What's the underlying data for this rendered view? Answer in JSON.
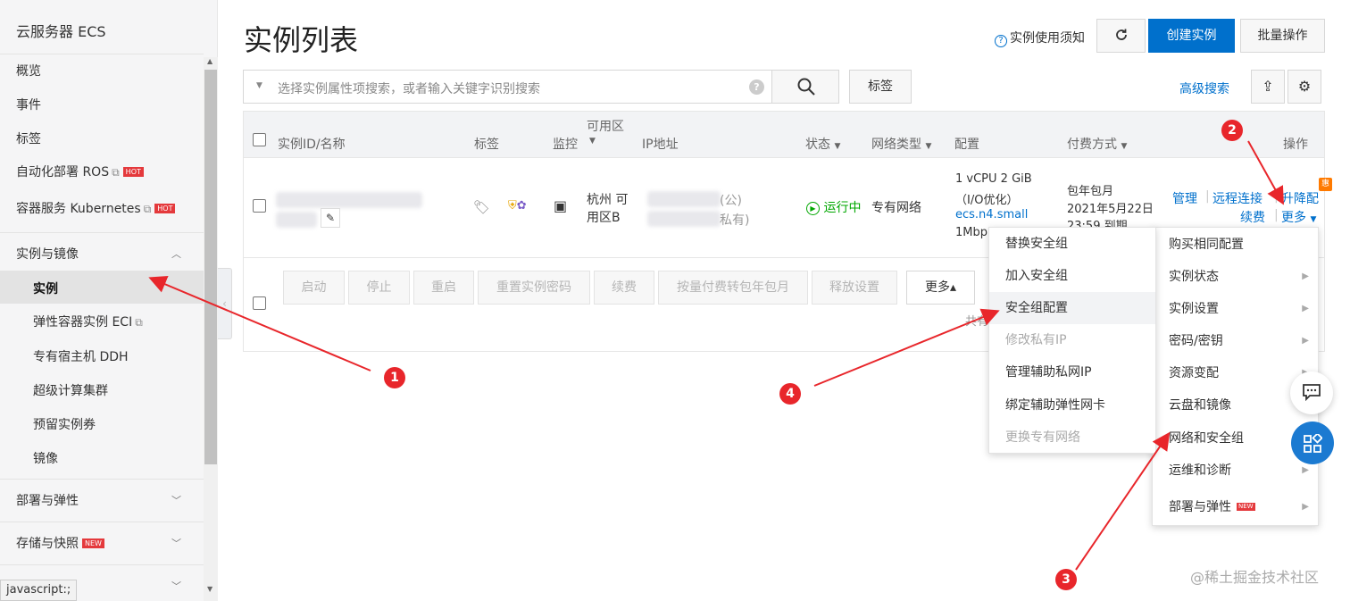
{
  "sidebar": {
    "title": "云服务器 ECS",
    "items": [
      {
        "label": "概览"
      },
      {
        "label": "事件"
      },
      {
        "label": "标签"
      },
      {
        "label": "自动化部署 ROS",
        "badge": "HOT"
      },
      {
        "label": "容器服务 Kubernetes",
        "badge": "HOT"
      }
    ],
    "group_instances": "实例与镜像",
    "sub_items": [
      {
        "label": "实例"
      },
      {
        "label": "弹性容器实例 ECI"
      },
      {
        "label": "专有宿主机 DDH"
      },
      {
        "label": "超级计算集群"
      },
      {
        "label": "预留实例券"
      },
      {
        "label": "镜像"
      }
    ],
    "group_deploy": "部署与弹性",
    "group_storage": "存储与快照",
    "storage_badge": "NEW"
  },
  "status_bar": "javascript:;",
  "header": {
    "title": "实例列表",
    "help": "实例使用须知",
    "create": "创建实例",
    "batch": "批量操作"
  },
  "search": {
    "placeholder": "选择实例属性项搜索，或者输入关键字识别搜索",
    "tag_btn": "标签",
    "advanced": "高级搜索"
  },
  "table": {
    "columns": [
      "实例ID/名称",
      "标签",
      "监控",
      "可用区",
      "IP地址",
      "状态",
      "网络类型",
      "配置",
      "付费方式",
      "操作"
    ],
    "row": {
      "zone": "杭州 可用区B",
      "zone_l1": "杭州 可",
      "zone_l2": "用区B",
      "ip_public": "(公)",
      "ip_private": "私有)",
      "status": "运行中",
      "network": "专有网络",
      "config_l1": "1 vCPU 2 GiB",
      "config_l2": "（I/O优化）",
      "config_l3": "ecs.n4.small",
      "config_l4": "1Mbp",
      "pay_l1": "包年包月",
      "pay_l2": "2021年5月22日",
      "pay_l3": "23:59 到期",
      "op_manage": "管理",
      "op_remote": "远程连接",
      "op_upgrade": "升降配",
      "op_renew": "续费",
      "op_more": "更多",
      "hui": "惠"
    },
    "actions": [
      "启动",
      "停止",
      "重启",
      "重置实例密码",
      "续费",
      "按量付费转包年包月",
      "释放设置",
      "更多▴"
    ],
    "footer_partial": "共有"
  },
  "menu_right": [
    {
      "label": "购买相同配置",
      "sub": false
    },
    {
      "label": "实例状态",
      "sub": true
    },
    {
      "label": "实例设置",
      "sub": true
    },
    {
      "label": "密码/密钥",
      "sub": true
    },
    {
      "label": "资源变配",
      "sub": true
    },
    {
      "label": "云盘和镜像",
      "sub": true
    },
    {
      "label": "网络和安全组",
      "sub": true
    },
    {
      "label": "运维和诊断",
      "sub": true
    },
    {
      "label": "部署与弹性",
      "sub": true,
      "badge": "NEW"
    }
  ],
  "menu_left": [
    {
      "label": "替换安全组",
      "disabled": false
    },
    {
      "label": "加入安全组",
      "disabled": false
    },
    {
      "label": "安全组配置",
      "disabled": false,
      "highlight": true
    },
    {
      "label": "修改私有IP",
      "disabled": true
    },
    {
      "label": "管理辅助私网IP",
      "disabled": false
    },
    {
      "label": "绑定辅助弹性网卡",
      "disabled": false
    },
    {
      "label": "更换专有网络",
      "disabled": true
    }
  ],
  "annotations": [
    "1",
    "2",
    "3",
    "4"
  ],
  "watermark": "@稀土掘金技术社区",
  "colors": {
    "accent": "#0070cc",
    "arrow": "#e8262b",
    "running": "#00a700"
  }
}
